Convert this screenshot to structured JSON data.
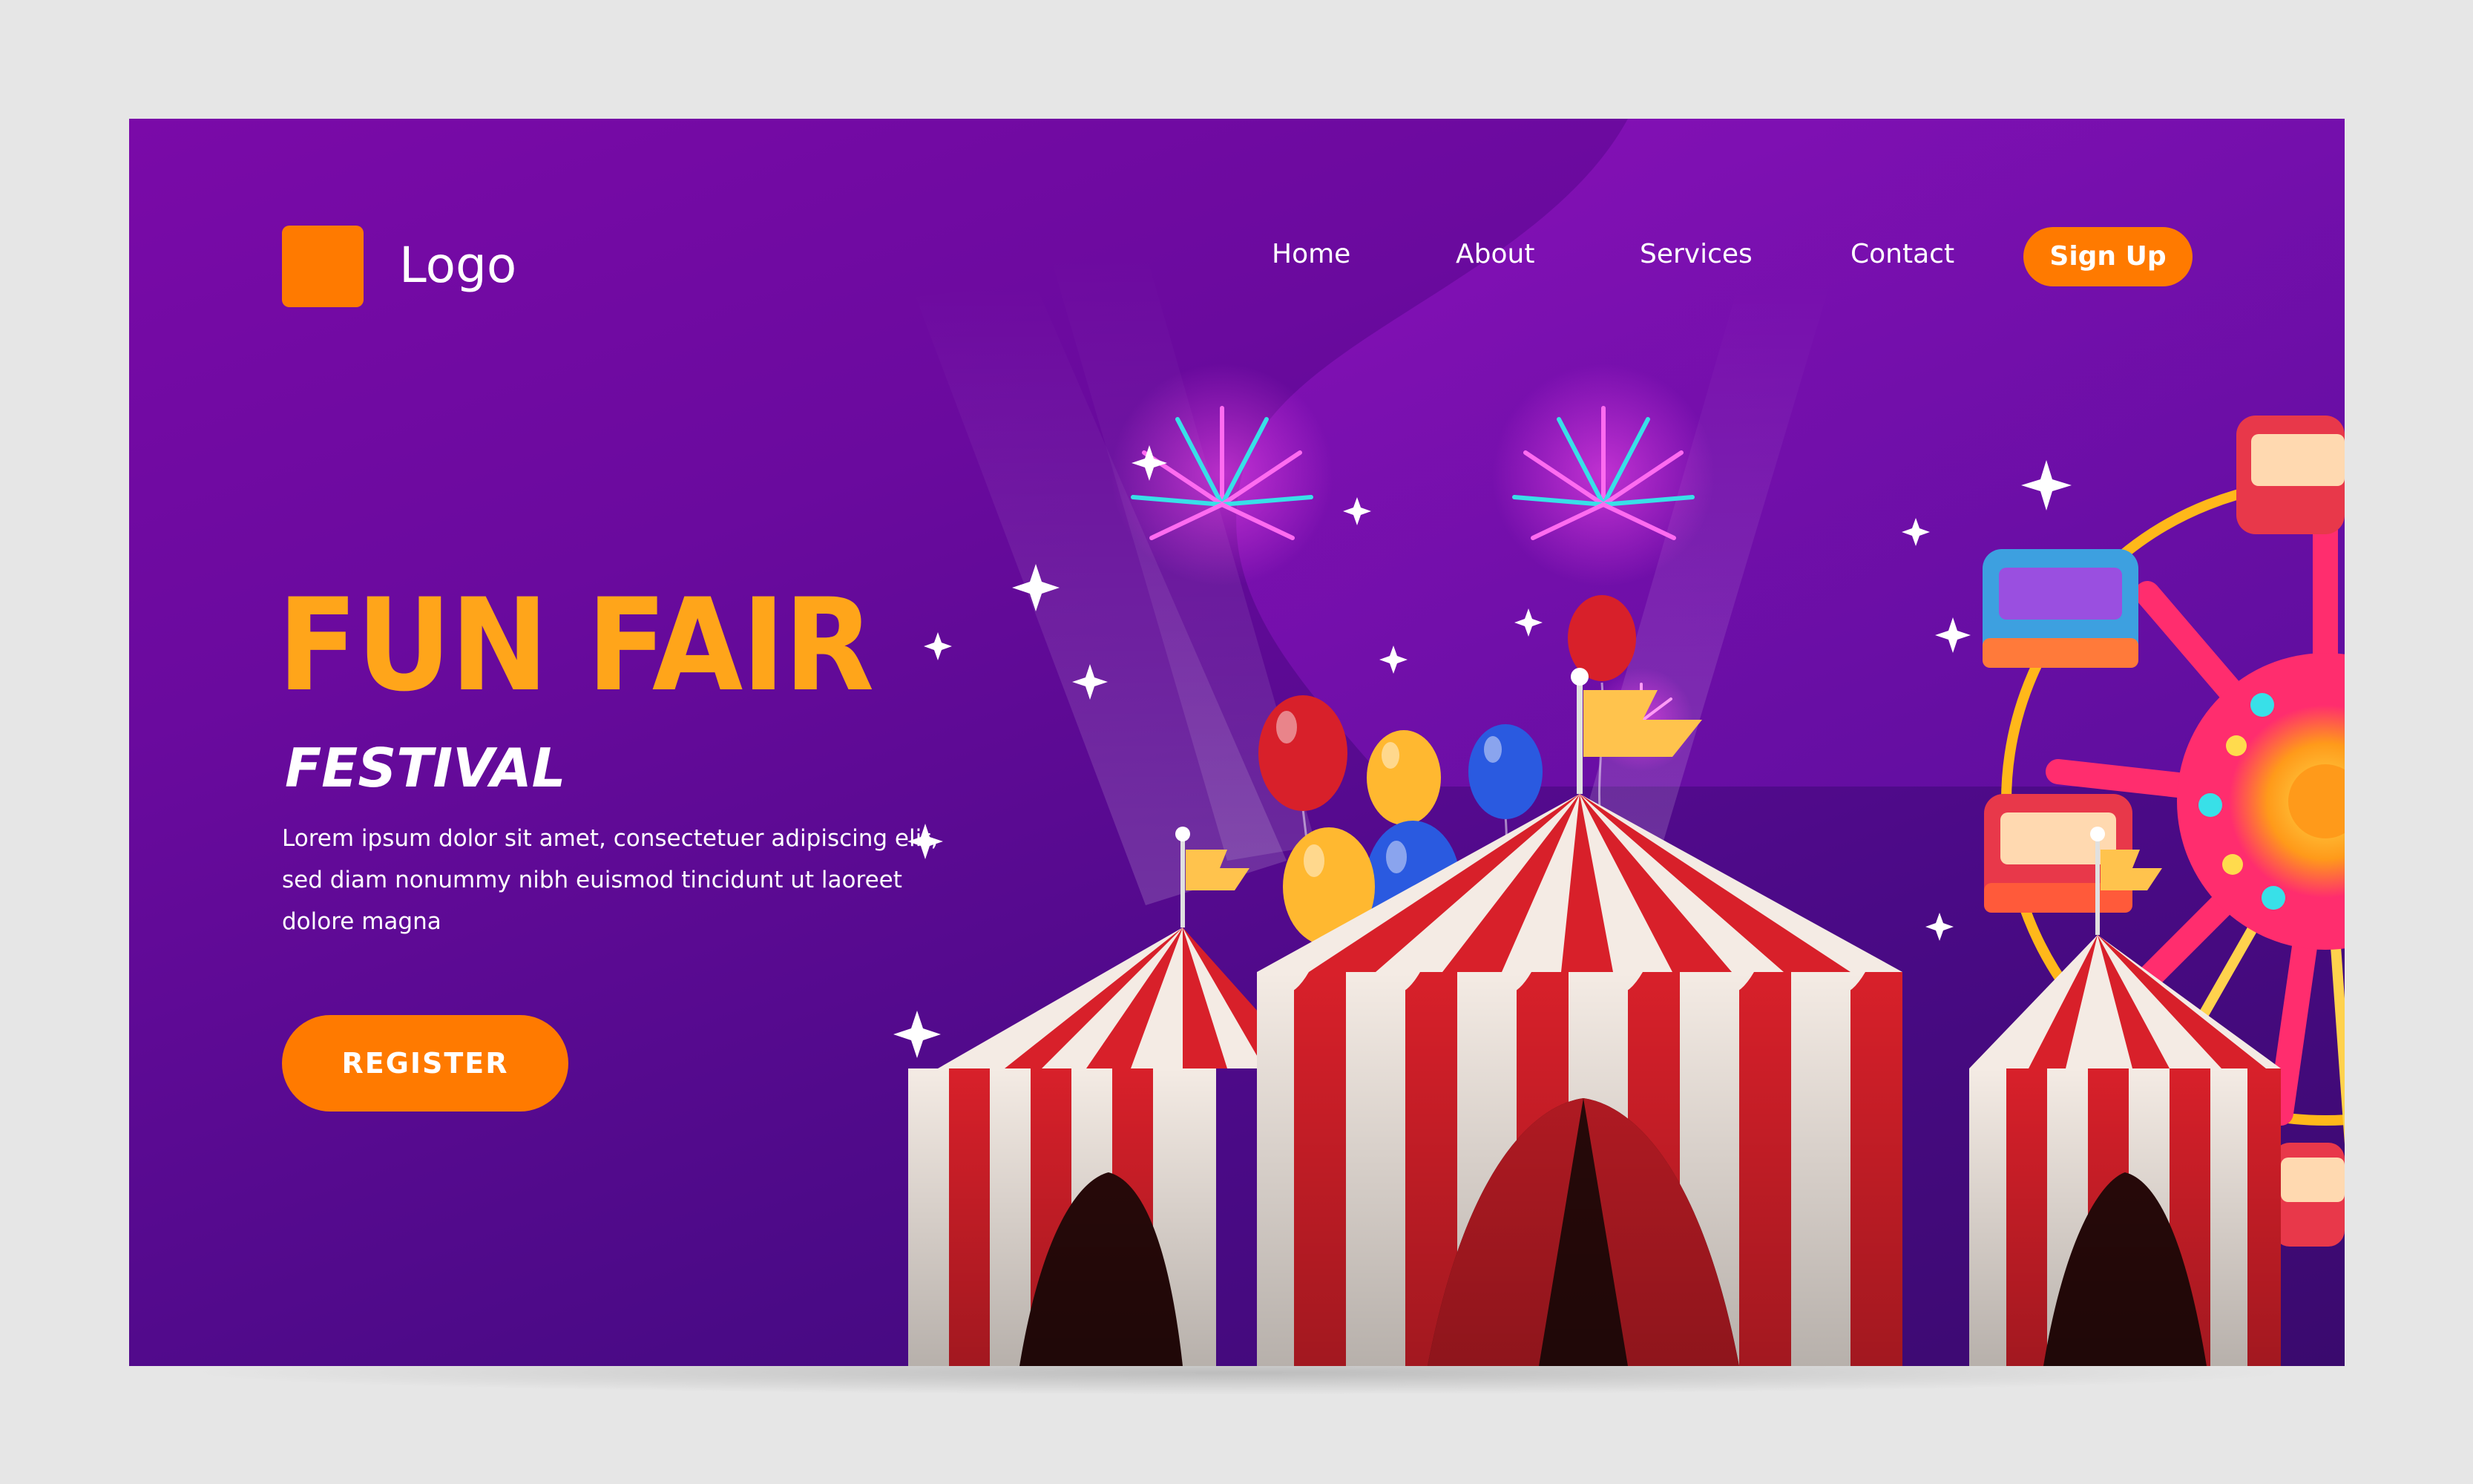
{
  "header": {
    "logo_text": "Logo",
    "nav": [
      "Home",
      "About",
      "Services",
      "Contact"
    ],
    "signup_label": "Sign Up"
  },
  "hero": {
    "title": "FUN FAIR",
    "subtitle": "FESTIVAL",
    "body": "Lorem ipsum dolor sit amet, consectetuer adipiscing elit, sed diam nonummy nibh euismod tincidunt ut laoreet dolore magna",
    "cta_label": "REGISTER"
  },
  "colors": {
    "accent": "#ff7a00",
    "title": "#ffa51a",
    "background": "#6a0a9e"
  },
  "icons": [
    "logo-icon",
    "firework-icon",
    "balloon-icon",
    "flag-icon",
    "circus-tent-icon",
    "ferris-wheel-icon",
    "sparkle-icon"
  ]
}
